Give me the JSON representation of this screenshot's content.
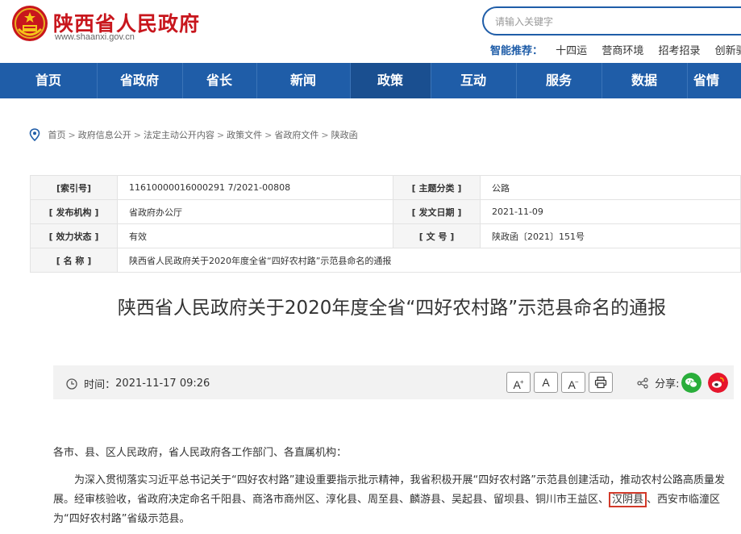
{
  "header": {
    "site_name": "陕西省人民政府",
    "site_url": "www.shaanxi.gov.cn",
    "search_placeholder": "请输入关键字",
    "smart_rec_label": "智能推荐：",
    "smart_rec_keywords": [
      "十四运",
      "营商环境",
      "招考招录",
      "创新驱动"
    ]
  },
  "nav": {
    "items": [
      "首页",
      "省政府",
      "省长",
      "新闻",
      "政策",
      "互动",
      "服务",
      "数据",
      "省情"
    ],
    "active": "政策"
  },
  "breadcrumb": [
    "首页",
    "政府信息公开",
    "法定主动公开内容",
    "政策文件",
    "省政府文件",
    "陕政函"
  ],
  "meta": {
    "index_no_label": "[索引号]",
    "index_no": "11610000016000291 7/2021-00808",
    "topic_label": "[ 主题分类 ]",
    "topic": "公路",
    "issuer_label": "[ 发布机构 ]",
    "issuer": "省政府办公厅",
    "date_label": "[ 发文日期 ]",
    "date": "2021-11-09",
    "status_label": "[ 效力状态 ]",
    "status": "有效",
    "doc_no_label": "[ 文 号 ]",
    "doc_no": "陕政函〔2021〕151号",
    "name_label": "[ 名 称 ]",
    "name": "陕西省人民政府关于2020年度全省“四好农村路”示范县命名的通报"
  },
  "article": {
    "title": "陕西省人民政府关于2020年度全省“四好农村路”示范县命名的通报",
    "time_label": "时间：",
    "time": "2021-11-17 09:26",
    "font_increase": "A",
    "font_normal": "A",
    "font_decrease": "A",
    "share_label": "分享:",
    "greeting": "各市、县、区人民政府，省人民政府各工作部门、各直属机构：",
    "para_before": "为深入贯彻落实习近平总书记关于“四好农村路”建设重要指示批示精神，我省积极开展“四好农村路”示范县创建活动，推动农村公路高质量发展。经审核验收，省政府决定命名千阳县、商洛市商州区、淳化县、周至县、麟游县、吴起县、留坝县、铜川市王益区、",
    "para_highlight": "汉阴县",
    "para_after": "、西安市临潼区为“四好农村路”省级示范县。"
  },
  "colors": {
    "brand_red": "#c8161d",
    "nav_blue": "#1f5da8",
    "highlight_border": "#d23a2a",
    "wechat_green": "#2aae3b",
    "weibo_red": "#e6162d"
  }
}
